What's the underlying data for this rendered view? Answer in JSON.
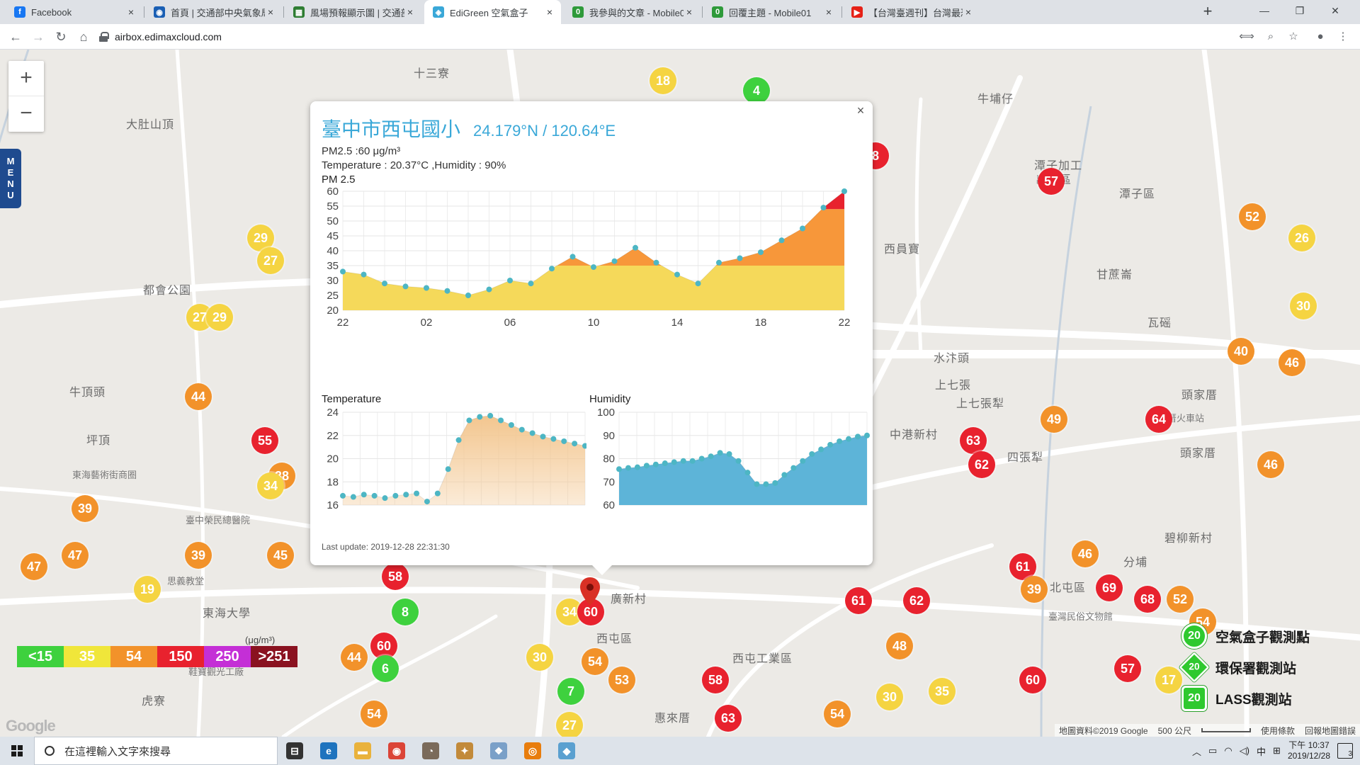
{
  "browser": {
    "tabs": [
      {
        "label": "Facebook",
        "icon": "facebook-icon",
        "color": "#1877f2",
        "glyph": "f"
      },
      {
        "label": "首頁 | 交通部中央氣象局",
        "icon": "cwb-icon",
        "color": "#1a5fb4",
        "glyph": "◉"
      },
      {
        "label": "風場預報顯示圖 | 交通部中央氣...",
        "icon": "cwb-windmap-icon",
        "color": "#2e7d32",
        "glyph": "▦"
      },
      {
        "label": "EdiGreen 空氣盒子",
        "icon": "edigreen-icon",
        "color": "#3aa8d8",
        "glyph": "◈"
      },
      {
        "label": "我參與的文章 - Mobile01",
        "icon": "mobile01-icon",
        "color": "#2e9a3a",
        "glyph": "0"
      },
      {
        "label": "回覆主題 - Mobile01",
        "icon": "mobile01-icon",
        "color": "#2e9a3a",
        "glyph": "0"
      },
      {
        "label": "【台灣臺週刊】台灣最恐怖的核...",
        "icon": "youtube-icon",
        "color": "#e62117",
        "glyph": "▶"
      }
    ],
    "active_tab": 3,
    "url": "airbox.edimaxcloud.com"
  },
  "map": {
    "zoom_in": "+",
    "zoom_out": "−",
    "menu_label": "MENU",
    "places": [
      {
        "text": "十三寮",
        "x": 584,
        "y": 20
      },
      {
        "text": "大肚山頂",
        "x": 178,
        "y": 92
      },
      {
        "text": "牛埔仔",
        "x": 1380,
        "y": 56
      },
      {
        "text": "潭子加工",
        "x": 1460,
        "y": 150
      },
      {
        "text": "出口區",
        "x": 1462,
        "y": 170
      },
      {
        "text": "潭子區",
        "x": 1580,
        "y": 190
      },
      {
        "text": "西員寶",
        "x": 1248,
        "y": 268
      },
      {
        "text": "甘蔗崙",
        "x": 1548,
        "y": 304
      },
      {
        "text": "都會公園",
        "x": 202,
        "y": 326
      },
      {
        "text": "瓦磘",
        "x": 1620,
        "y": 372
      },
      {
        "text": "水汴頭",
        "x": 1318,
        "y": 422
      },
      {
        "text": "上七張",
        "x": 1320,
        "y": 460
      },
      {
        "text": "上七張犁",
        "x": 1350,
        "y": 486
      },
      {
        "text": "頭家厝",
        "x": 1668,
        "y": 474
      },
      {
        "text": "牛頂頭",
        "x": 98,
        "y": 470
      },
      {
        "text": "中港新村",
        "x": 1256,
        "y": 530
      },
      {
        "text": "四張犁",
        "x": 1422,
        "y": 562
      },
      {
        "text": "頭家厝",
        "x": 1666,
        "y": 556
      },
      {
        "text": "坪頂",
        "x": 122,
        "y": 538
      },
      {
        "text": "碧柳新村",
        "x": 1644,
        "y": 676
      },
      {
        "text": "北屯區",
        "x": 1482,
        "y": 746
      },
      {
        "text": "分埔",
        "x": 1586,
        "y": 710
      },
      {
        "text": "西屯區",
        "x": 842,
        "y": 818
      },
      {
        "text": "西屯工業區",
        "x": 1034,
        "y": 846
      },
      {
        "text": "廣新村",
        "x": 862,
        "y": 762
      },
      {
        "text": "東海大學",
        "x": 286,
        "y": 782
      },
      {
        "text": "虎寮",
        "x": 200,
        "y": 906
      },
      {
        "text": "惠來厝",
        "x": 924,
        "y": 930
      }
    ],
    "small_places": [
      {
        "text": "東海藝術街商圈",
        "x": 102,
        "y": 590
      },
      {
        "text": "臺中榮民總醫院",
        "x": 262,
        "y": 654
      },
      {
        "text": "思義教堂",
        "x": 236,
        "y": 740
      },
      {
        "text": "鞋寶觀光工廠",
        "x": 266,
        "y": 868
      },
      {
        "text": "頭家厝火車站",
        "x": 1622,
        "y": 510
      },
      {
        "text": "臺灣民俗文物館",
        "x": 1480,
        "y": 790
      }
    ],
    "markers": [
      {
        "v": "18",
        "x": 936,
        "y": 114,
        "c": "#f5d442"
      },
      {
        "v": "4",
        "x": 1068,
        "y": 128,
        "c": "#3ed13e"
      },
      {
        "v": "8",
        "x": 1236,
        "y": 220,
        "c": "#e8222e"
      },
      {
        "v": "57",
        "x": 1484,
        "y": 256,
        "c": "#e8222e"
      },
      {
        "v": "52",
        "x": 1768,
        "y": 306,
        "c": "#f2922a"
      },
      {
        "v": "26",
        "x": 1838,
        "y": 336,
        "c": "#f5d442"
      },
      {
        "v": "29",
        "x": 368,
        "y": 336,
        "c": "#f5d442"
      },
      {
        "v": "27",
        "x": 382,
        "y": 368,
        "c": "#f5d442"
      },
      {
        "v": "30",
        "x": 1840,
        "y": 432,
        "c": "#f5d442"
      },
      {
        "v": "27",
        "x": 282,
        "y": 448,
        "c": "#f5d442"
      },
      {
        "v": "29",
        "x": 310,
        "y": 448,
        "c": "#f5d442"
      },
      {
        "v": "40",
        "x": 1752,
        "y": 496,
        "c": "#f2922a"
      },
      {
        "v": "46",
        "x": 1824,
        "y": 512,
        "c": "#f2922a"
      },
      {
        "v": "44",
        "x": 280,
        "y": 560,
        "c": "#f2922a"
      },
      {
        "v": "64",
        "x": 1636,
        "y": 592,
        "c": "#e8222e"
      },
      {
        "v": "49",
        "x": 1488,
        "y": 592,
        "c": "#f2922a"
      },
      {
        "v": "63",
        "x": 1374,
        "y": 622,
        "c": "#e8222e"
      },
      {
        "v": "62",
        "x": 1386,
        "y": 656,
        "c": "#e8222e"
      },
      {
        "v": "46",
        "x": 1794,
        "y": 656,
        "c": "#f2922a"
      },
      {
        "v": "55",
        "x": 374,
        "y": 622,
        "c": "#e8222e"
      },
      {
        "v": "38",
        "x": 398,
        "y": 672,
        "c": "#f2922a"
      },
      {
        "v": "34",
        "x": 382,
        "y": 686,
        "c": "#f5d442"
      },
      {
        "v": "39",
        "x": 120,
        "y": 718,
        "c": "#f2922a"
      },
      {
        "v": "47",
        "x": 106,
        "y": 784,
        "c": "#f2922a"
      },
      {
        "v": "47",
        "x": 48,
        "y": 800,
        "c": "#f2922a"
      },
      {
        "v": "39",
        "x": 280,
        "y": 784,
        "c": "#f2922a"
      },
      {
        "v": "45",
        "x": 396,
        "y": 784,
        "c": "#f2922a"
      },
      {
        "v": "46",
        "x": 1532,
        "y": 782,
        "c": "#f2922a"
      },
      {
        "v": "61",
        "x": 1444,
        "y": 800,
        "c": "#e8222e"
      },
      {
        "v": "19",
        "x": 208,
        "y": 832,
        "c": "#f5d442"
      },
      {
        "v": "58",
        "x": 558,
        "y": 814,
        "c": "#e8222e"
      },
      {
        "v": "39",
        "x": 1460,
        "y": 832,
        "c": "#f2922a"
      },
      {
        "v": "69",
        "x": 1566,
        "y": 830,
        "c": "#e8222e"
      },
      {
        "v": "68",
        "x": 1620,
        "y": 846,
        "c": "#e8222e"
      },
      {
        "v": "52",
        "x": 1666,
        "y": 846,
        "c": "#f2922a"
      },
      {
        "v": "61",
        "x": 1212,
        "y": 848,
        "c": "#e8222e"
      },
      {
        "v": "62",
        "x": 1294,
        "y": 848,
        "c": "#e8222e"
      },
      {
        "v": "8",
        "x": 572,
        "y": 864,
        "c": "#3ed13e"
      },
      {
        "v": "34",
        "x": 804,
        "y": 864,
        "c": "#f5d442"
      },
      {
        "v": "60",
        "x": 834,
        "y": 864,
        "c": "#e8222e"
      },
      {
        "v": "54",
        "x": 1698,
        "y": 878,
        "c": "#f2922a"
      },
      {
        "v": "60",
        "x": 542,
        "y": 912,
        "c": "#e8222e"
      },
      {
        "v": "48",
        "x": 1270,
        "y": 912,
        "c": "#f2922a"
      },
      {
        "v": "30",
        "x": 762,
        "y": 928,
        "c": "#f5d442"
      },
      {
        "v": "44",
        "x": 500,
        "y": 928,
        "c": "#f2922a"
      },
      {
        "v": "54",
        "x": 840,
        "y": 934,
        "c": "#f2922a"
      },
      {
        "v": "6",
        "x": 544,
        "y": 944,
        "c": "#3ed13e"
      },
      {
        "v": "57",
        "x": 1592,
        "y": 944,
        "c": "#e8222e"
      },
      {
        "v": "60",
        "x": 1458,
        "y": 960,
        "c": "#e8222e"
      },
      {
        "v": "58",
        "x": 1010,
        "y": 960,
        "c": "#e8222e"
      },
      {
        "v": "53",
        "x": 878,
        "y": 960,
        "c": "#f2922a"
      },
      {
        "v": "17",
        "x": 1650,
        "y": 960,
        "c": "#f5d442"
      },
      {
        "v": "7",
        "x": 806,
        "y": 976,
        "c": "#3ed13e"
      },
      {
        "v": "35",
        "x": 1330,
        "y": 976,
        "c": "#f5d442"
      },
      {
        "v": "30",
        "x": 1256,
        "y": 984,
        "c": "#f5d442"
      },
      {
        "v": "54",
        "x": 528,
        "y": 1008,
        "c": "#f2922a"
      },
      {
        "v": "54",
        "x": 1182,
        "y": 1008,
        "c": "#f2922a"
      },
      {
        "v": "63",
        "x": 1028,
        "y": 1014,
        "c": "#e8222e"
      },
      {
        "v": "27",
        "x": 804,
        "y": 1024,
        "c": "#f5d442"
      }
    ],
    "legend": [
      {
        "label": "<15",
        "color": "#3ed13e"
      },
      {
        "label": "35",
        "color": "#f0e63a"
      },
      {
        "label": "54",
        "color": "#f2922a"
      },
      {
        "label": "150",
        "color": "#e8222e"
      },
      {
        "label": "250",
        "color": "#c42fd6"
      },
      {
        "label": ">251",
        "color": "#8a1220"
      }
    ],
    "legend_unit": "(μg/m³)",
    "google_logo": "Google",
    "station_legend": [
      {
        "badge": "20",
        "label": "空氣盒子觀測點"
      },
      {
        "badge": "20",
        "label": "環保署觀測站"
      },
      {
        "badge": "20",
        "label": "LASS觀測站"
      }
    ],
    "footer": {
      "attribution": "地圖資料©2019 Google",
      "scale": "500 公尺",
      "terms": "使用條款",
      "report": "回報地圖錯誤"
    }
  },
  "popup": {
    "close": "×",
    "title": "臺中市西屯國小",
    "coords": "24.179°N / 120.64°E",
    "pm_line": "PM2.5 :60 μg/m³",
    "temp_line": "Temperature : 20.37°C ,Humidity : 90%",
    "last_update": "Last update: 2019-12-28 22:31:30"
  },
  "chart_data": [
    {
      "type": "area",
      "title": "PM 2.5",
      "x": [
        22,
        23,
        0,
        1,
        2,
        3,
        4,
        5,
        6,
        7,
        8,
        9,
        10,
        11,
        12,
        13,
        14,
        15,
        16,
        17,
        18,
        19,
        20,
        21,
        22
      ],
      "x_tick_labels": [
        "22",
        "02",
        "06",
        "10",
        "14",
        "18",
        "22"
      ],
      "values": [
        33,
        32,
        29,
        28,
        27.5,
        26.5,
        25,
        27,
        30,
        29,
        34,
        38,
        34.5,
        36.5,
        41,
        36,
        32,
        29,
        36,
        37.5,
        39.5,
        43.5,
        47.5,
        54.5,
        60
      ],
      "ylim": [
        20,
        60
      ],
      "y_ticks": [
        20,
        25,
        30,
        35,
        40,
        45,
        50,
        55,
        60
      ],
      "color_bands": [
        {
          "upto": 35,
          "color": "#f5d95a"
        },
        {
          "upto": 54,
          "color": "#f7973a"
        },
        {
          "upto": 60,
          "color": "#e8222e"
        }
      ],
      "point_color": "#4db6c4",
      "grid": true
    },
    {
      "type": "area",
      "title": "Temperature",
      "values": [
        16.8,
        16.7,
        16.9,
        16.8,
        16.6,
        16.8,
        16.9,
        17.0,
        16.3,
        17.0,
        19.1,
        21.6,
        23.3,
        23.6,
        23.7,
        23.3,
        22.9,
        22.5,
        22.2,
        21.9,
        21.7,
        21.5,
        21.3,
        21.1
      ],
      "ylim": [
        16,
        24
      ],
      "y_ticks": [
        16,
        18,
        20,
        22,
        24
      ],
      "fill": "#f3c68f",
      "point_color": "#4db6c4",
      "grid": true
    },
    {
      "type": "area",
      "title": "Humidity",
      "values": [
        75.5,
        76,
        76.3,
        77,
        77.5,
        78,
        78.5,
        79,
        79,
        80,
        81,
        82.5,
        82,
        79,
        74,
        69,
        69,
        69.5,
        73,
        76,
        79,
        82,
        84,
        86,
        87.5,
        88.5,
        89.5,
        90
      ],
      "ylim": [
        60,
        100
      ],
      "y_ticks": [
        60,
        70,
        80,
        90,
        100
      ],
      "fill": "#5db4d8",
      "point_color": "#4db6c4",
      "grid": true
    }
  ],
  "taskbar": {
    "search_placeholder": "在這裡輸入文字來搜尋",
    "apps": [
      {
        "icon": "task-view-icon",
        "glyph": "⊟",
        "color": "#333333"
      },
      {
        "icon": "edge-icon",
        "glyph": "e",
        "color": "#1e73be"
      },
      {
        "icon": "file-explorer-icon",
        "glyph": "▬",
        "color": "#e9b23c"
      },
      {
        "icon": "chrome-icon",
        "glyph": "◉",
        "color": "#db4437"
      },
      {
        "icon": "app-clock-icon",
        "glyph": "◔",
        "color": "#7a6a5a"
      },
      {
        "icon": "app-mascot-icon",
        "glyph": "✦",
        "color": "#c28a3a"
      },
      {
        "icon": "app-network-icon",
        "glyph": "❖",
        "color": "#7aa0c8"
      },
      {
        "icon": "blender-icon",
        "glyph": "◎",
        "color": "#e87d0d"
      },
      {
        "icon": "app-box-icon",
        "glyph": "◆",
        "color": "#5aa0d0"
      }
    ],
    "tray": {
      "ime": "中",
      "time_line1": "下午 10:37",
      "time_line2": "2019/12/28",
      "notifications": "3"
    }
  }
}
